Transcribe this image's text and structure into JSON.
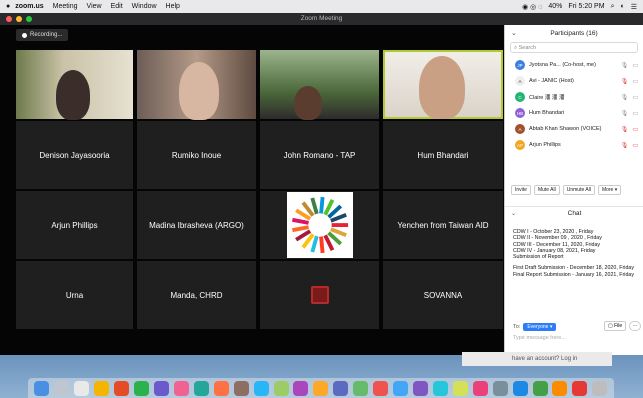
{
  "menubar": {
    "apple": "",
    "app": "zoom.us",
    "items": [
      "Meeting",
      "View",
      "Edit",
      "Window",
      "Help"
    ],
    "wifi": "40%",
    "clock": "Fri 5:20 PM"
  },
  "window": {
    "title": "Zoom Meeting"
  },
  "recording": {
    "label": "Recording..."
  },
  "tiles": [
    {
      "name": "",
      "kind": "video1"
    },
    {
      "name": "",
      "kind": "video2"
    },
    {
      "name": "",
      "kind": "video3"
    },
    {
      "name": "",
      "kind": "video4",
      "active": true
    },
    {
      "name": "Denison Jayasooria"
    },
    {
      "name": "Rumiko Inoue"
    },
    {
      "name": "John Romano - TAP"
    },
    {
      "name": "Hum Bhandari"
    },
    {
      "name": "Arjun Phillips"
    },
    {
      "name": "Madina Ibrasheva (ARGO)"
    },
    {
      "name": "",
      "kind": "sdg"
    },
    {
      "name": "Yenchen from Taiwan AID"
    },
    {
      "name": "Urna"
    },
    {
      "name": "Manda, CHRD"
    },
    {
      "name": "",
      "kind": "logo"
    },
    {
      "name": "SOVANNA"
    }
  ],
  "participants": {
    "title": "Participants (16)",
    "search_placeholder": "Search",
    "list": [
      {
        "initial": "JP",
        "name": "Jyotsna Pa...  (Co-host, me)",
        "color": "#3f7fdc",
        "mic": "🎙",
        "cam": "▭",
        "muted": false
      },
      {
        "initial": "A",
        "name": "Avi - JANIC (Host)",
        "color": "#ffffff",
        "mic": "🎙",
        "cam": "▭",
        "muted": true
      },
      {
        "initial": "C",
        "name": "Claire 潘 潘 潘",
        "color": "#22b573",
        "mic": "🎙",
        "cam": "▭",
        "muted": false
      },
      {
        "initial": "HB",
        "name": "Hum Bhandari",
        "color": "#8e62d6",
        "mic": "🎙",
        "cam": "▭",
        "muted": false
      },
      {
        "initial": "A",
        "name": "Abtab Khan Shawon (VOICE)",
        "color": "#a0522d",
        "mic": "🎙",
        "cam": "▭",
        "muted": true
      },
      {
        "initial": "AP",
        "name": "Arjun Phillips",
        "color": "#f2a623",
        "mic": "🎙",
        "cam": "▭",
        "muted": true
      }
    ],
    "buttons": {
      "invite": "Invite",
      "mute_all": "Mute All",
      "unmute_all": "Unmute All",
      "more": "More ▾"
    }
  },
  "chat": {
    "title": "Chat",
    "lines": [
      "CDW I - October 23, 2020 , Friday",
      "CDW II - November 09 , 2020 , Friday",
      "CDW III - December 11, 2020, Friday",
      "CDW IV - January 08, 2021, Friday",
      "Submission of Report",
      "",
      "First Draft Submission - December 18, 2020, Friday",
      "Final Report Submission - January 16, 2021, Friday"
    ],
    "to_label": "To:",
    "to_value": "Everyone ▾",
    "file_label": "File",
    "more_label": "···",
    "input_placeholder": "Type message here..."
  },
  "signin": {
    "text": "have an account?  Log in"
  },
  "colors": {
    "active_outline": "#b4c833",
    "accent": "#2d7df6",
    "muted": "#d9342b"
  },
  "dock": {
    "icons": [
      "finder-icon",
      "launchpad-icon",
      "safari-icon",
      "chrome-icon",
      "app-icon",
      "app-icon",
      "app-icon",
      "app-icon",
      "app-icon",
      "app-icon",
      "app-icon",
      "app-icon",
      "app-icon",
      "app-icon",
      "app-icon",
      "app-icon",
      "app-icon",
      "app-icon",
      "app-icon",
      "app-icon",
      "app-icon",
      "app-icon",
      "app-icon",
      "app-icon",
      "app-icon",
      "app-icon",
      "app-icon",
      "app-icon",
      "trash-icon"
    ]
  }
}
